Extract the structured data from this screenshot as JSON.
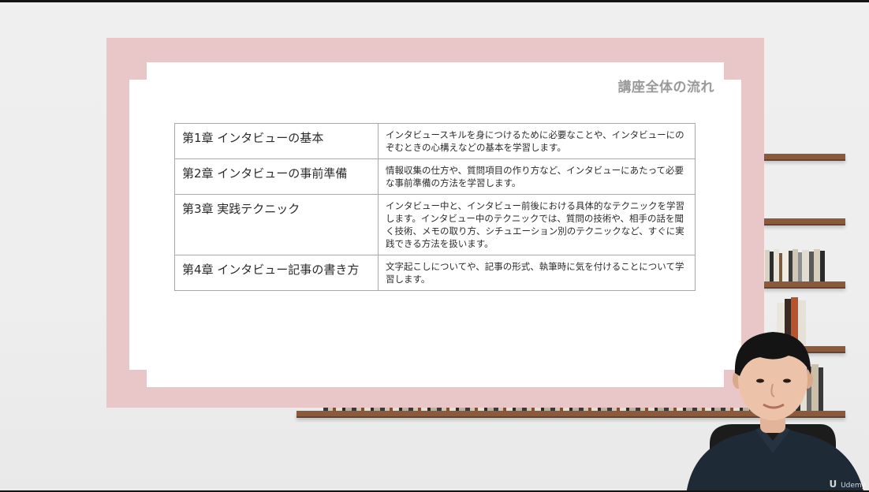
{
  "slide": {
    "title": "講座全体の流れ",
    "rows": [
      {
        "chapter": "第1章 インタビューの基本",
        "description": "インタビュースキルを身につけるために必要なことや、インタビューにのぞむときの心構えなどの基本を学習します。"
      },
      {
        "chapter": "第2章 インタビューの事前準備",
        "description": "情報収集の仕方や、質問項目の作り方など、インタビューにあたって必要な事前準備の方法を学習します。"
      },
      {
        "chapter": "第3章 実践テクニック",
        "description": "インタビュー中と、インタビュー前後における具体的なテクニックを学習します。インタビュー中のテクニックでは、質問の技術や、相手の話を聞く技術、メモの取り方、シチュエーション別のテクニックなど、すぐに実践できる方法を扱います。"
      },
      {
        "chapter": "第4章 インタビュー記事の書き方",
        "description": "文字起こしについてや、記事の形式、執筆時に気を付けることについて学習します。"
      }
    ]
  },
  "watermark": {
    "logo": "U",
    "text": "Udemy"
  },
  "colors": {
    "frame": "#e9c7c8",
    "slide_bg": "#ffffff",
    "title": "#9a9a9a",
    "shelf": "#8a5a3a",
    "wall": "#eeeeee"
  }
}
